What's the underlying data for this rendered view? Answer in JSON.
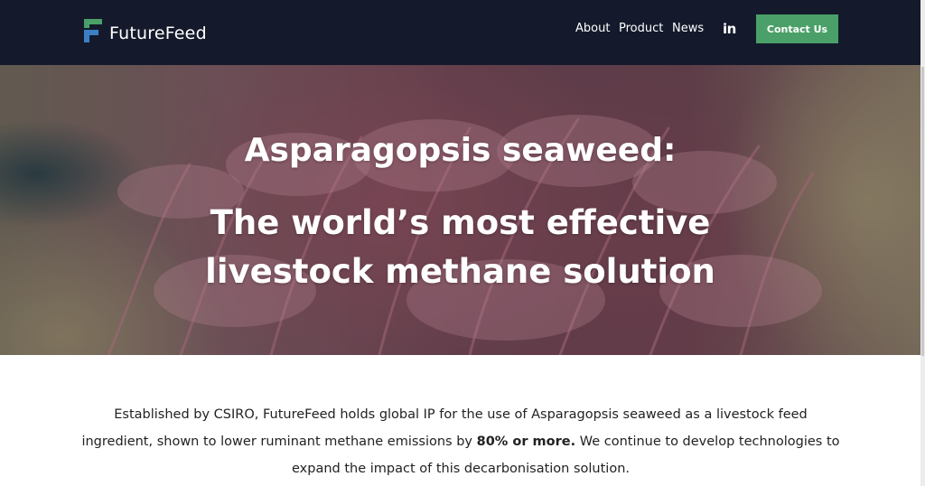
{
  "header": {
    "brand": "FutureFeed",
    "nav": [
      {
        "label": "About"
      },
      {
        "label": "Product"
      },
      {
        "label": "News"
      }
    ],
    "social_label": "in",
    "cta_label": "Contact Us"
  },
  "hero": {
    "title": "Asparagopsis seaweed:",
    "subtitle_line1": "The world’s most effective",
    "subtitle_line2": "livestock methane solution"
  },
  "intro": {
    "before": "Established by CSIRO, FutureFeed holds global IP for the use of Asparagopsis seaweed as a livestock feed ingredient, shown to lower ruminant methane emissions by ",
    "highlight": "80% or more.",
    "after": " We continue to develop technologies to expand the impact of this decarbonisation solution."
  },
  "colors": {
    "navbar": "#141a2b",
    "cta": "#4aa068",
    "logo_green": "#4aa068",
    "logo_blue": "#3d7fc4"
  },
  "icons": {
    "logo": "futurefeed-logo-mark",
    "social": "linkedin-icon"
  }
}
